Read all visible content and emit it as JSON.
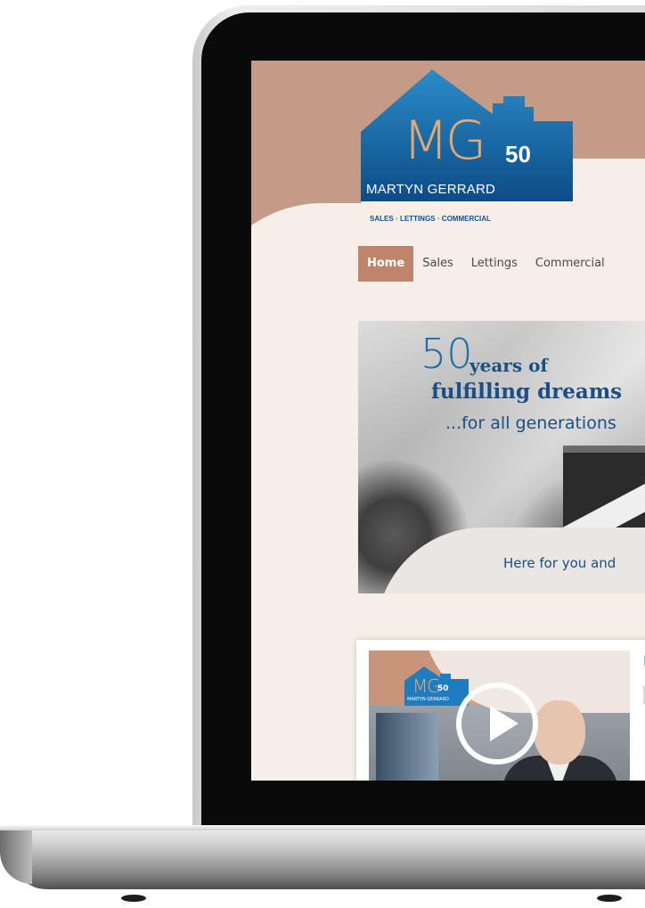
{
  "logo": {
    "mg": "MG",
    "fifty": "50",
    "name": "MARTYN GERRARD",
    "tag_sales": "SALES",
    "tag_lettings": "LETTINGS",
    "tag_commercial": "COMMERCIAL",
    "tag_separator": "•"
  },
  "nav": {
    "items": [
      {
        "label": "Home",
        "active": true
      },
      {
        "label": "Sales",
        "active": false
      },
      {
        "label": "Lettings",
        "active": false
      },
      {
        "label": "Commercial",
        "active": false
      }
    ]
  },
  "hero": {
    "big_number": "50",
    "years": "years of",
    "line2": "fulfilling dreams",
    "line3": "...for all generations",
    "footer": "Here for you and"
  },
  "video": {
    "mini_logo_mg": "MG",
    "mini_logo_num": "50",
    "mini_logo_text": "MARTYN GERRARD",
    "side_letter": "F"
  },
  "colors": {
    "brand_blue": "#1a6aa6",
    "brand_tan": "#c39b86",
    "nav_active": "#c0846a",
    "logo_orange": "#e9a86f"
  }
}
